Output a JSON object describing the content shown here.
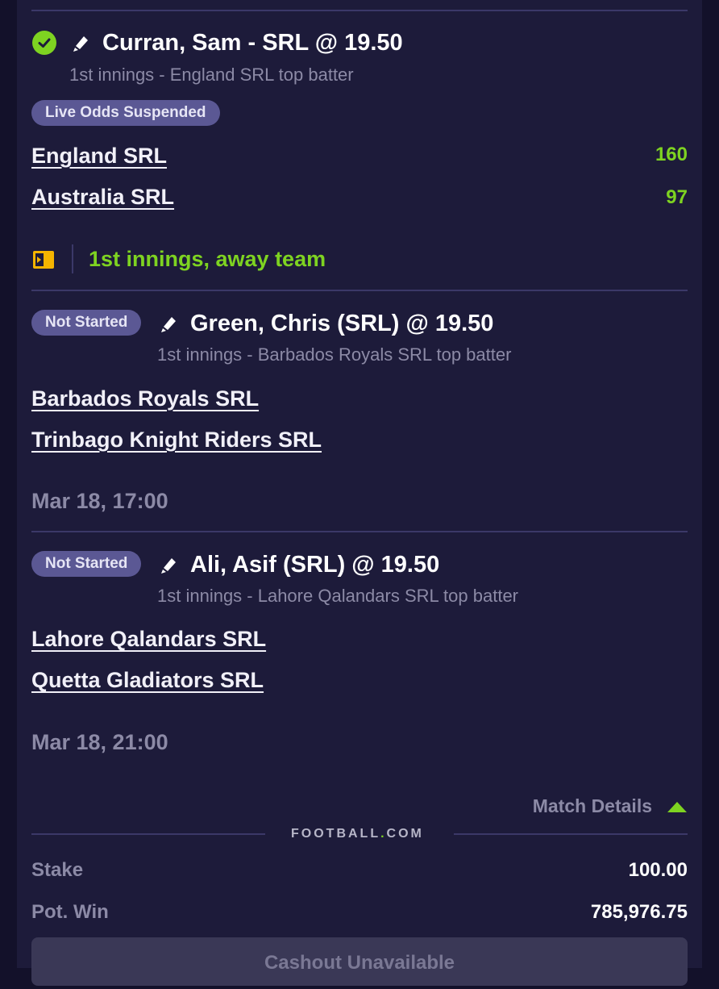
{
  "bets": [
    {
      "title": "Curran, Sam - SRL @ 19.50",
      "subtitle": "1st innings - England SRL top batter",
      "badge": "Live Odds Suspended",
      "teams": [
        {
          "name": "England SRL",
          "score": "160"
        },
        {
          "name": "Australia SRL",
          "score": "97"
        }
      ],
      "live_status": "1st innings, away team"
    },
    {
      "status": "Not Started",
      "title": "Green, Chris (SRL) @ 19.50",
      "subtitle": "1st innings - Barbados Royals SRL top batter",
      "teams": [
        {
          "name": "Barbados Royals SRL"
        },
        {
          "name": "Trinbago Knight Riders SRL"
        }
      ],
      "datetime": "Mar 18, 17:00"
    },
    {
      "status": "Not Started",
      "title": "Ali, Asif (SRL) @ 19.50",
      "subtitle": "1st innings - Lahore Qalandars SRL top batter",
      "teams": [
        {
          "name": "Lahore Qalandars SRL"
        },
        {
          "name": "Quetta Gladiators SRL"
        }
      ],
      "datetime": "Mar 18, 21:00"
    }
  ],
  "match_details_label": "Match Details",
  "brand": {
    "text_a": "FOOTBALL",
    "dot": ".",
    "text_b": "COM"
  },
  "stake": {
    "label": "Stake",
    "value": "100.00"
  },
  "pot_win": {
    "label": "Pot. Win",
    "value": "785,976.75"
  },
  "cashout_label": "Cashout Unavailable",
  "colors": {
    "background": "#1d1b3a",
    "accent_green": "#7ed321",
    "badge": "#5b5894",
    "muted_text": "#8c8aa6"
  },
  "icons": [
    "check-circle-icon",
    "pen-icon",
    "scoreboard-icon",
    "caret-up-icon"
  ]
}
